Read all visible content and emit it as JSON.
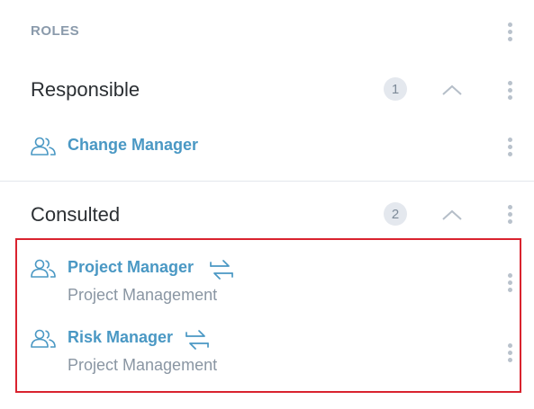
{
  "roles_header": {
    "title": "ROLES"
  },
  "sections": [
    {
      "title": "Responsible",
      "count": "1",
      "roles": [
        {
          "name": "Change Manager",
          "subtitle": ""
        }
      ]
    },
    {
      "title": "Consulted",
      "count": "2",
      "roles": [
        {
          "name": "Project Manager",
          "subtitle": "Project Management"
        },
        {
          "name": "Risk Manager",
          "subtitle": "Project Management"
        }
      ]
    }
  ],
  "colors": {
    "accent": "#4a98c4",
    "highlight_border": "#d9232f",
    "muted": "#8a9aab"
  },
  "icons": {
    "role": "people-icon",
    "swap": "swap-arrows-icon",
    "collapse": "chevron-up-icon",
    "menu": "kebab-menu-icon"
  }
}
